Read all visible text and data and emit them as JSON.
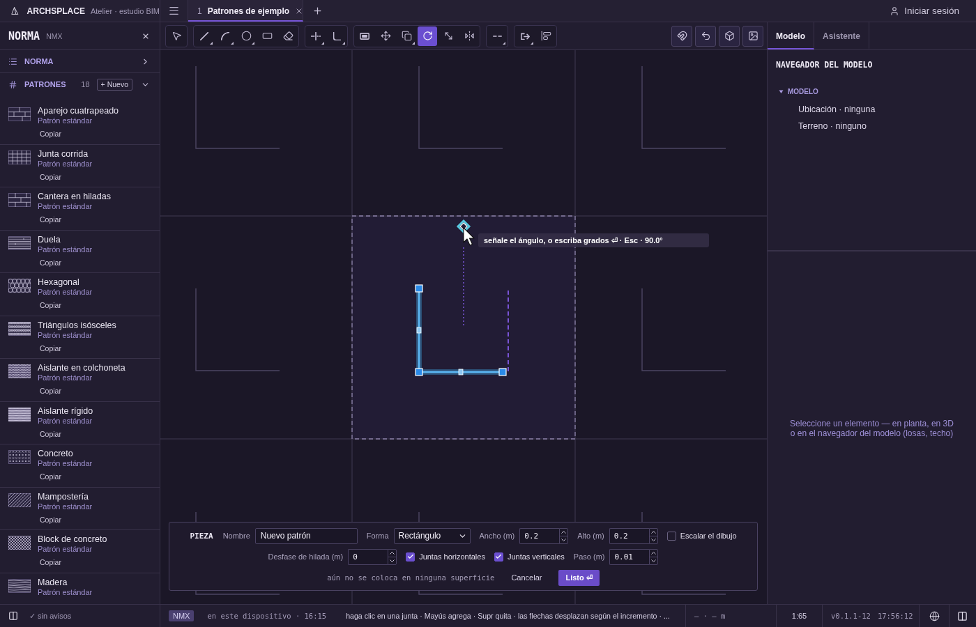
{
  "app": {
    "name": "ARCHSPLACE",
    "workspace": "Atelier · estudio BIM"
  },
  "tabs": [
    {
      "number": "1",
      "title": "Patrones de ejemplo",
      "selected": true
    }
  ],
  "account": {
    "label": "Iniciar sesión"
  },
  "sidebar": {
    "title": "NORMA",
    "code": "NMX",
    "sections": [
      {
        "label": "NORMA",
        "expanded": false
      },
      {
        "label": "PATRONES",
        "count": "18",
        "action": "+ Nuevo",
        "expanded": true
      }
    ],
    "patterns": [
      {
        "name": "Aparejo cuatrapeado",
        "subtitle": "Patrón estándar",
        "action": "Copiar"
      },
      {
        "name": "Junta corrida",
        "subtitle": "Patrón estándar",
        "action": "Copiar"
      },
      {
        "name": "Cantera en hiladas",
        "subtitle": "Patrón estándar",
        "action": "Copiar"
      },
      {
        "name": "Duela",
        "subtitle": "Patrón estándar",
        "action": "Copiar"
      },
      {
        "name": "Hexagonal",
        "subtitle": "Patrón estándar",
        "action": "Copiar"
      },
      {
        "name": "Triángulos isósceles",
        "subtitle": "Patrón estándar",
        "action": "Copiar"
      },
      {
        "name": "Aislante en colchoneta",
        "subtitle": "Patrón estándar",
        "action": "Copiar"
      },
      {
        "name": "Aislante rígido",
        "subtitle": "Patrón estándar",
        "action": "Copiar"
      },
      {
        "name": "Concreto",
        "subtitle": "Patrón estándar",
        "action": "Copiar"
      },
      {
        "name": "Mampostería",
        "subtitle": "Patrón estándar",
        "action": "Copiar"
      },
      {
        "name": "Block de concreto",
        "subtitle": "Patrón estándar",
        "action": "Copiar"
      },
      {
        "name": "Madera",
        "subtitle": "Patrón estándar"
      }
    ]
  },
  "toolbar": {
    "groups": [
      {
        "tools": [
          {
            "selected": false,
            "submenu": false
          }
        ]
      },
      {
        "tools": [
          {
            "selected": false,
            "submenu": true
          },
          {
            "selected": false,
            "submenu": true
          },
          {
            "selected": false,
            "submenu": true
          },
          {
            "selected": false,
            "submenu": false
          },
          {
            "selected": false,
            "submenu": false
          }
        ]
      },
      {
        "tools": [
          {
            "selected": false,
            "submenu": true
          },
          {
            "selected": false,
            "submenu": true
          }
        ]
      },
      {
        "tools": [
          {
            "selected": false,
            "submenu": false
          },
          {
            "selected": false,
            "submenu": false
          },
          {
            "selected": false,
            "submenu": true
          },
          {
            "selected": true,
            "submenu": false
          },
          {
            "selected": false,
            "submenu": false
          },
          {
            "selected": false,
            "submenu": false
          }
        ]
      },
      {
        "tools": [
          {
            "selected": false,
            "submenu": true
          }
        ]
      },
      {
        "tools": [
          {
            "selected": false,
            "submenu": true
          },
          {
            "selected": false,
            "submenu": false
          }
        ]
      }
    ]
  },
  "canvas": {
    "tooltip": "señale el ángulo, o escriba grados ⏎ · Esc · 90.0°"
  },
  "piece_form": {
    "rows": [
      {
        "items": [
          {
            "kind": "heading",
            "text": "PIEZA"
          },
          {
            "kind": "text",
            "label": "Nombre",
            "value": "Nuevo patrón"
          },
          {
            "kind": "select",
            "label": "Forma",
            "value": "Rectángulo"
          },
          {
            "kind": "number",
            "label": "Ancho (m)",
            "value": "0.2"
          },
          {
            "kind": "number",
            "label": "Alto (m)",
            "value": "0.2"
          },
          {
            "kind": "checkbox",
            "label": "Escalar el dibujo",
            "checked": false
          }
        ]
      },
      {
        "items": [
          {
            "kind": "number",
            "label": "Desfase de hilada (m)",
            "value": "0"
          },
          {
            "kind": "checkbox",
            "label": "Juntas horizontales",
            "checked": true
          },
          {
            "kind": "checkbox",
            "label": "Juntas verticales",
            "checked": true
          },
          {
            "kind": "number",
            "label": "Paso (m)",
            "value": "0.01"
          }
        ]
      },
      {
        "items": [
          {
            "kind": "note",
            "text": "aún no se coloca en ninguna superficie"
          },
          {
            "kind": "button",
            "text": "Cancelar",
            "primary": false
          },
          {
            "kind": "button",
            "text": "Listo ⏎",
            "primary": true
          }
        ]
      }
    ]
  },
  "right_panel": {
    "tabs": [
      {
        "label": "Modelo",
        "selected": true
      },
      {
        "label": "Asistente",
        "selected": false
      }
    ],
    "navigator": {
      "title": "NAVEGADOR DEL MODELO",
      "tree": [
        {
          "label": "MODELO",
          "expanded": true,
          "children": [
            {
              "label": "Ubicación · ninguna"
            },
            {
              "label": "Terreno · ninguno"
            }
          ]
        }
      ]
    },
    "hint": "Seleccione un elemento — en planta, en 3D o en el navegador del modelo (losas, techo)"
  },
  "status_bar": {
    "warnings": "✓ sin avisos",
    "standard": "NMX",
    "saved": "en este dispositivo · 16:15",
    "hint": "haga clic en una junta · Mayús agrega · Supr quita · las flechas desplazan según el incremento · ...",
    "coordinates": "— · — m",
    "scale": "1:65",
    "version": "v0.1.1-12",
    "clock": "17:56:12"
  }
}
